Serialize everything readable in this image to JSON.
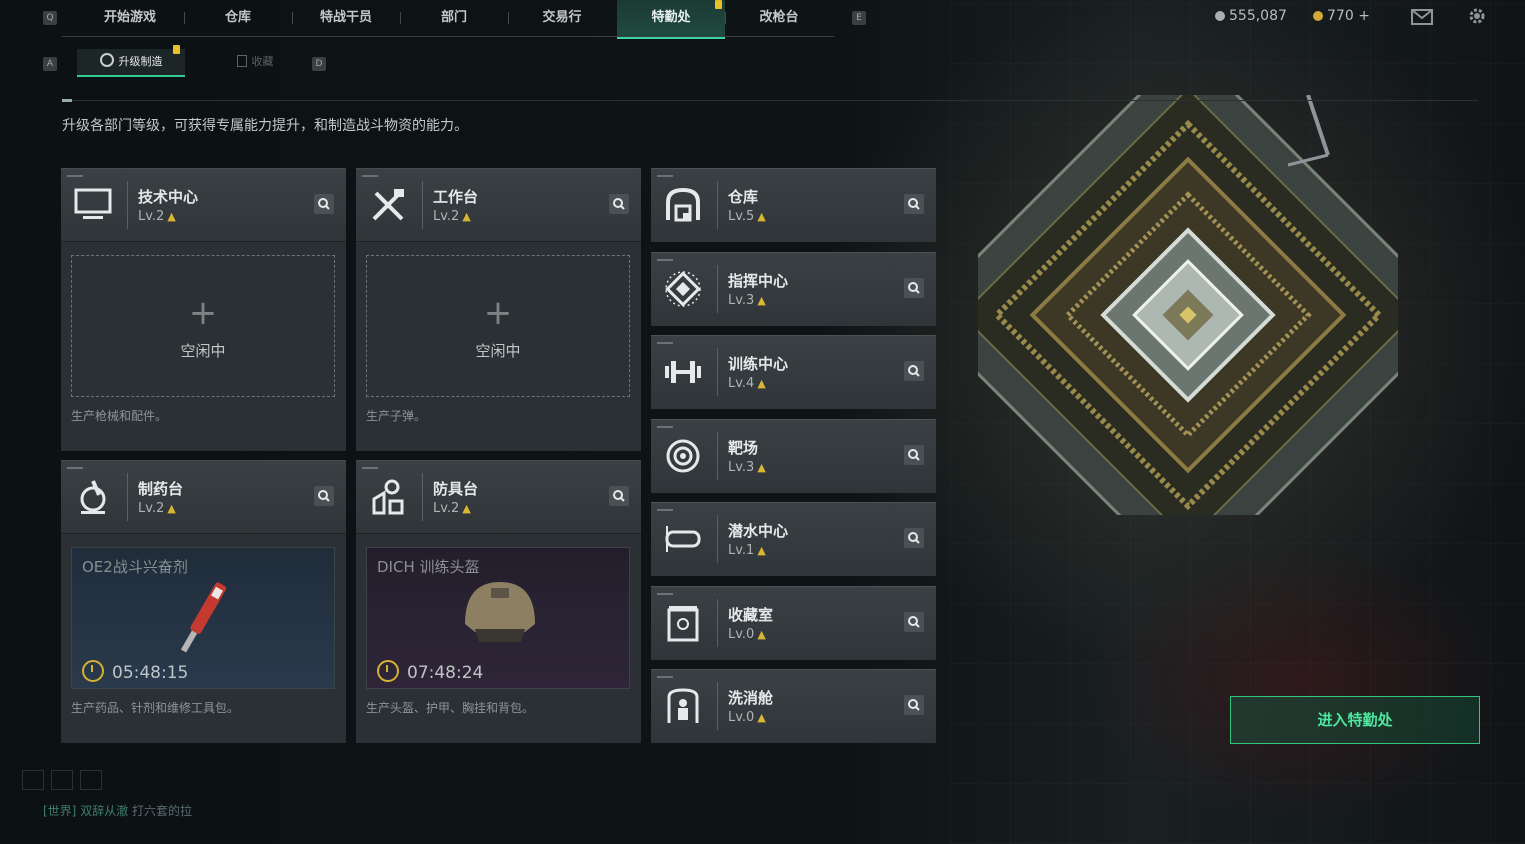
{
  "top_nav": {
    "left_key": "Q",
    "right_key": "E",
    "tabs": [
      {
        "label": "开始游戏"
      },
      {
        "label": "仓库"
      },
      {
        "label": "特战干员"
      },
      {
        "label": "部门"
      },
      {
        "label": "交易行"
      },
      {
        "label": "特勤处",
        "active": true
      },
      {
        "label": "改枪台"
      }
    ]
  },
  "currency": {
    "silver": "555,087",
    "gold": "770",
    "add": "+"
  },
  "sub_nav": {
    "left_key": "A",
    "right_key": "D",
    "tabs": [
      {
        "label": "升级制造",
        "active": true
      },
      {
        "label": "收藏"
      }
    ]
  },
  "description": "升级各部门等级，可获得专属能力提升，和制造战斗物资的能力。",
  "stations": [
    {
      "name": "技术中心",
      "level": "Lv.2",
      "state": "空闲中",
      "footer": "生产枪械和配件。",
      "icon": "monitor-icon"
    },
    {
      "name": "工作台",
      "level": "Lv.2",
      "state": "空闲中",
      "footer": "生产子弹。",
      "icon": "tools-icon"
    },
    {
      "name": "制药台",
      "level": "Lv.2",
      "product": "OE2战斗兴奋剂",
      "timer": "05:48:15",
      "footer": "生产药品、针剂和维修工具包。",
      "icon": "microscope-icon"
    },
    {
      "name": "防具台",
      "level": "Lv.2",
      "product": "DICH 训练头盔",
      "timer": "07:48:24",
      "footer": "生产头盔、护甲、胸挂和背包。",
      "icon": "armor-icon"
    }
  ],
  "departments": [
    {
      "name": "仓库",
      "level": "Lv.5",
      "icon": "warehouse-icon"
    },
    {
      "name": "指挥中心",
      "level": "Lv.3",
      "icon": "command-icon"
    },
    {
      "name": "训练中心",
      "level": "Lv.4",
      "icon": "dumbbell-icon"
    },
    {
      "name": "靶场",
      "level": "Lv.3",
      "icon": "target-icon"
    },
    {
      "name": "潜水中心",
      "level": "Lv.1",
      "icon": "diving-mask-icon"
    },
    {
      "name": "收藏室",
      "level": "Lv.0",
      "icon": "collection-icon"
    },
    {
      "name": "洗消舱",
      "level": "Lv.0",
      "icon": "decon-icon"
    }
  ],
  "enter_button": "进入特勤处",
  "chat": {
    "channel": "[世界]",
    "user": "双辞从澈",
    "message": "打六套的拉"
  },
  "colors": {
    "accent_green": "#39d6a0",
    "level_chevron": "#d8b633",
    "badge_yellow": "#e8c12a"
  }
}
